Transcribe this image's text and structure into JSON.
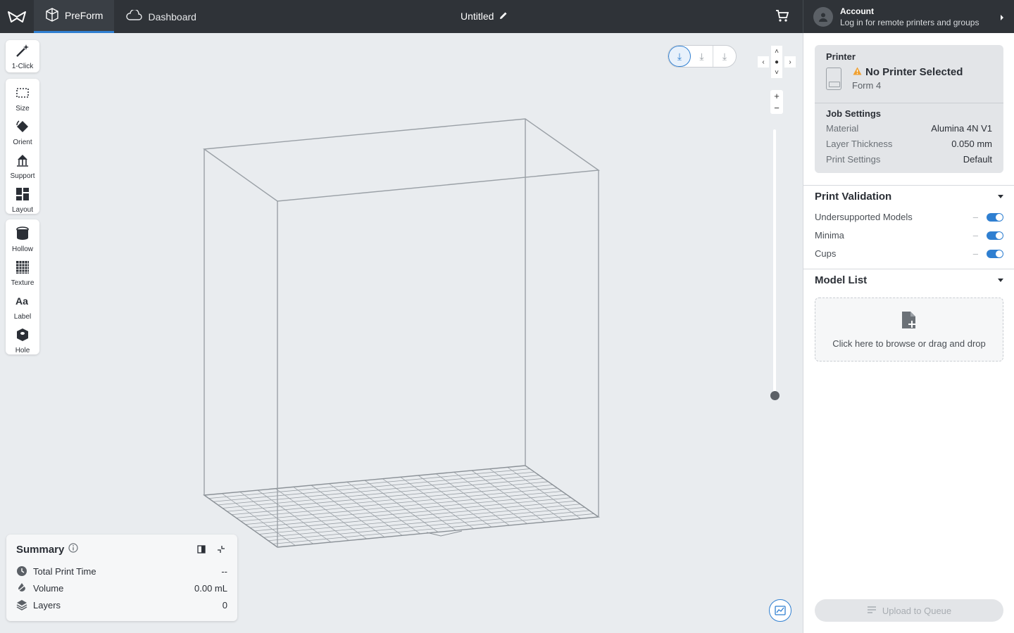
{
  "app": {
    "tabs": [
      {
        "label": "PreForm",
        "icon": "preform-cube-icon",
        "active": true
      },
      {
        "label": "Dashboard",
        "icon": "cloud-icon",
        "active": false
      }
    ],
    "document_title": "Untitled",
    "accent_color": "#2f7fd1"
  },
  "account": {
    "title": "Account",
    "subtitle": "Log in for remote printers and groups"
  },
  "tools": {
    "group1": [
      {
        "label": "1-Click",
        "icon": "magic-wand-icon"
      }
    ],
    "group2": [
      {
        "label": "Size",
        "icon": "size-box-icon"
      },
      {
        "label": "Orient",
        "icon": "orient-icon"
      },
      {
        "label": "Support",
        "icon": "support-icon"
      },
      {
        "label": "Layout",
        "icon": "layout-grid-icon"
      }
    ],
    "group3": [
      {
        "label": "Hollow",
        "icon": "hollow-cylinder-icon"
      },
      {
        "label": "Texture",
        "icon": "texture-grid-icon"
      },
      {
        "label": "Label",
        "icon": "text-aa-icon"
      },
      {
        "label": "Hole",
        "icon": "hole-cube-icon"
      }
    ]
  },
  "summary": {
    "title": "Summary",
    "rows": [
      {
        "label": "Total Print Time",
        "value": "--",
        "icon": "clock-icon"
      },
      {
        "label": "Volume",
        "value": "0.00 mL",
        "icon": "drop-icon"
      },
      {
        "label": "Layers",
        "value": "0",
        "icon": "layers-icon"
      }
    ]
  },
  "printer": {
    "section_title": "Printer",
    "status": "No Printer Selected",
    "model": "Form 4",
    "warning_color": "#f0a030"
  },
  "job_settings": {
    "title": "Job Settings",
    "rows": [
      {
        "label": "Material",
        "value": "Alumina 4N V1"
      },
      {
        "label": "Layer Thickness",
        "value": "0.050 mm"
      },
      {
        "label": "Print Settings",
        "value": "Default"
      }
    ]
  },
  "print_validation": {
    "title": "Print Validation",
    "items": [
      {
        "label": "Undersupported Models",
        "value": "–",
        "enabled": true
      },
      {
        "label": "Minima",
        "value": "–",
        "enabled": true
      },
      {
        "label": "Cups",
        "value": "–",
        "enabled": true
      }
    ]
  },
  "model_list": {
    "title": "Model List",
    "dropzone_text": "Click here to browse or drag and drop"
  },
  "upload": {
    "label": "Upload to Queue",
    "enabled": false
  }
}
